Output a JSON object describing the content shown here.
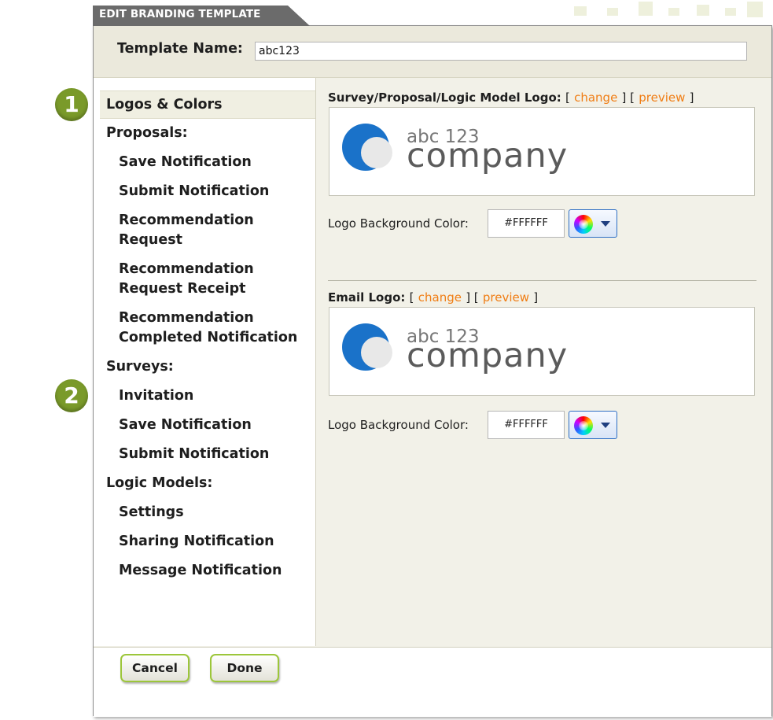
{
  "dialog": {
    "title": "EDIT BRANDING TEMPLATE",
    "template_name_label": "Template Name:",
    "template_name_value": "abc123"
  },
  "sidebar": {
    "selected": "Logos & Colors",
    "items": [
      {
        "label": "Logos & Colors"
      },
      {
        "label": "Proposals:"
      },
      {
        "label": "Save Notification"
      },
      {
        "label": "Submit Notification"
      },
      {
        "label": "Recommendation"
      },
      {
        "label": "Request"
      },
      {
        "label": "Recommendation"
      },
      {
        "label": "Request Receipt"
      },
      {
        "label": "Recommendation"
      },
      {
        "label": "Completed Notification"
      },
      {
        "label": "Surveys:"
      },
      {
        "label": "Invitation"
      },
      {
        "label": "Save Notification"
      },
      {
        "label": "Submit Notification"
      },
      {
        "label": "Logic Models:"
      },
      {
        "label": "Settings"
      },
      {
        "label": "Sharing Notification"
      },
      {
        "label": "Message Notification"
      }
    ]
  },
  "markers": [
    "1",
    "2"
  ],
  "main": {
    "survey_logo": {
      "label": "Survey/Proposal/Logic Model Logo:",
      "bracket_open": "[",
      "change_link": "change",
      "bracket_mid": "] [",
      "preview_link": "preview",
      "bracket_close": "]",
      "logo_text_small": "abc 123",
      "logo_text_big": "company",
      "bg_color_label": "Logo Background Color:",
      "bg_color_value": "#FFFFFF"
    },
    "email_logo": {
      "label": "Email Logo:",
      "bracket_open": "[",
      "change_link": "change",
      "bracket_mid": "] [",
      "preview_link": "preview",
      "bracket_close": "]",
      "logo_text_small": "abc 123",
      "logo_text_big": "company",
      "bg_color_label": "Logo Background Color:",
      "bg_color_value": "#FFFFFF"
    }
  },
  "footer": {
    "cancel_label": "Cancel",
    "done_label": "Done"
  },
  "colors": {
    "accent_orange": "#f07d14",
    "marker_green": "#7a9a2a",
    "button_border_green": "#9cc63a"
  },
  "icons": [
    "color-wheel-icon",
    "chevron-down-icon",
    "logo-mark-icon"
  ]
}
